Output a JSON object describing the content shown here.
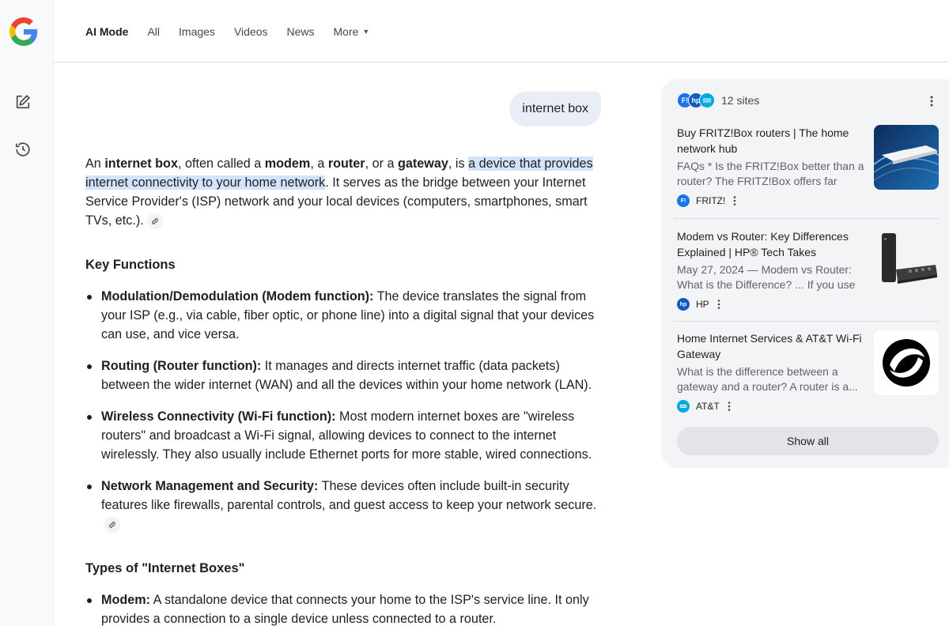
{
  "nav": {
    "tabs": [
      {
        "label": "AI Mode",
        "active": true
      },
      {
        "label": "All"
      },
      {
        "label": "Images"
      },
      {
        "label": "Videos"
      },
      {
        "label": "News"
      },
      {
        "label": "More"
      }
    ]
  },
  "rail": {
    "icons": [
      "google-logo",
      "new-chat-icon",
      "history-icon"
    ]
  },
  "query": "internet box",
  "answer": {
    "intro": {
      "t1": "An ",
      "b1": "internet box",
      "t2": ", often called a ",
      "b2": "modem",
      "t3": ", a ",
      "b3": "router",
      "t4": ", or a ",
      "b4": "gateway",
      "t5": ", is ",
      "highlight": "a device that provides internet connectivity to your home network",
      "t6": ". It serves as the bridge between your Internet Service Provider's (ISP) network and your local devices (computers, smartphones, smart TVs, etc.)."
    },
    "section1_title": "Key Functions",
    "functions": [
      {
        "term": "Modulation/Demodulation (Modem function):",
        "text": " The device translates the signal from your ISP (e.g., via cable, fiber optic, or phone line) into a digital signal that your devices can use, and vice versa."
      },
      {
        "term": "Routing (Router function):",
        "text": " It manages and directs internet traffic (data packets) between the wider internet (WAN) and all the devices within your home network (LAN)."
      },
      {
        "term": "Wireless Connectivity (Wi-Fi function):",
        "text": " Most modern internet boxes are \"wireless routers\" and broadcast a Wi-Fi signal, allowing devices to connect to the internet wirelessly. They also usually include Ethernet ports for more stable, wired connections."
      },
      {
        "term": "Network Management and Security:",
        "text": " These devices often include built-in security features like firewalls, parental controls, and guest access to keep your network secure."
      }
    ],
    "section2_title": "Types of \"Internet Boxes\"",
    "types": [
      {
        "term": "Modem:",
        "text": " A standalone device that connects your home to the ISP's service line. It only provides a connection to a single device unless connected to a router."
      }
    ]
  },
  "sources": {
    "count_label": "12 sites",
    "cards": [
      {
        "title": "Buy FRITZ!Box routers | The home network hub",
        "snippet": "FAQs * Is the FRITZ!Box better than a router? The FRITZ!Box offers far mor...",
        "source": "FRITZ!",
        "fav_color": "#1a73e8",
        "fav_text": "F!"
      },
      {
        "title": "Modem vs Router: Key Differences Explained | HP® Tech Takes",
        "snippet": "May 27, 2024 — Modem vs Router: What is the Difference? ... If you use ...",
        "source": "HP",
        "fav_color": "#0f5bc2",
        "fav_text": "hp"
      },
      {
        "title": "Home Internet Services & AT&T Wi-Fi Gateway",
        "snippet": "What is the difference between a gateway and a router? A router is a...",
        "source": "AT&T",
        "fav_color": "#00a8e0",
        "fav_text": ""
      }
    ],
    "show_all": "Show all"
  }
}
